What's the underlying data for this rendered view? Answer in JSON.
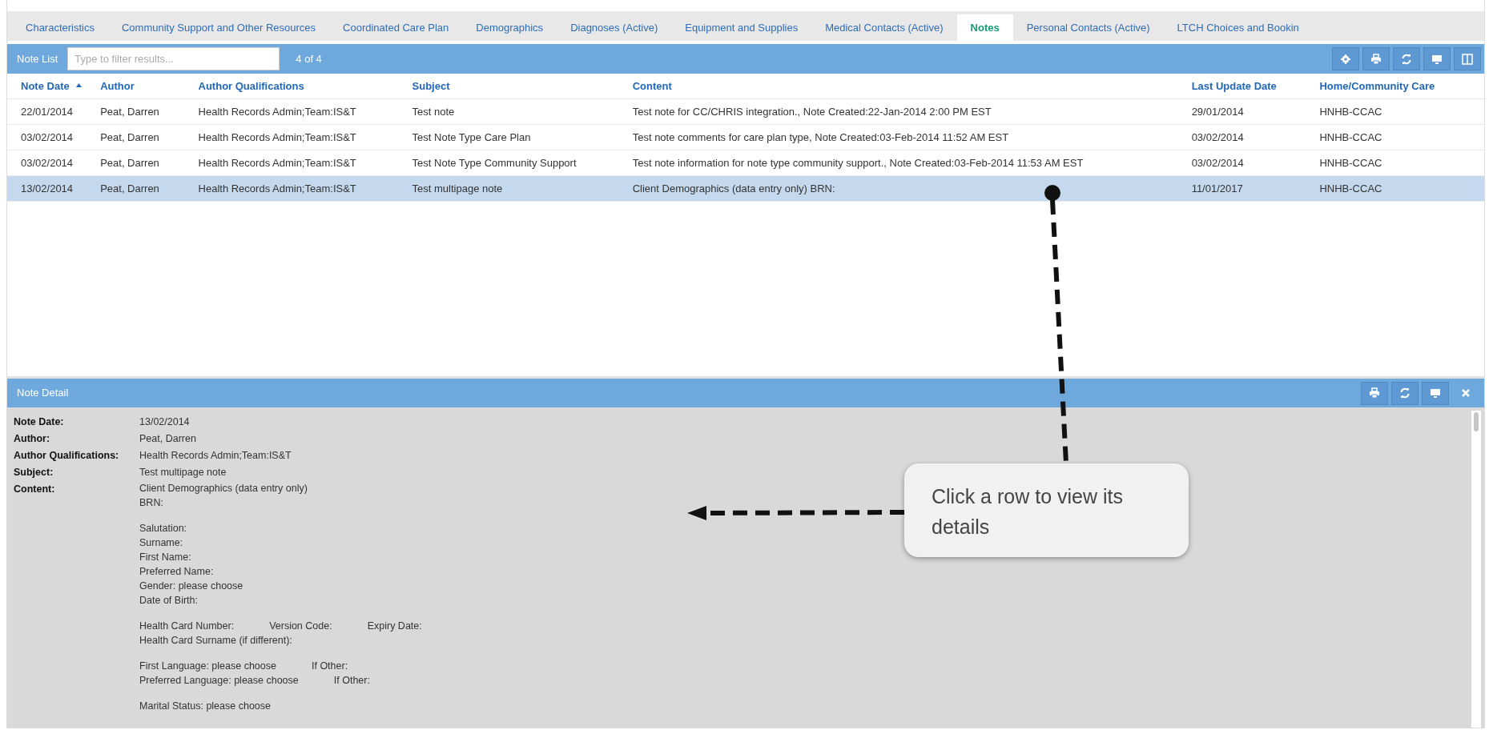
{
  "tabs": [
    {
      "label": "Characteristics",
      "selected": false
    },
    {
      "label": "Community Support and Other Resources",
      "selected": false
    },
    {
      "label": "Coordinated Care Plan",
      "selected": false
    },
    {
      "label": "Demographics",
      "selected": false
    },
    {
      "label": "Diagnoses (Active)",
      "selected": false
    },
    {
      "label": "Equipment and Supplies",
      "selected": false
    },
    {
      "label": "Medical Contacts (Active)",
      "selected": false
    },
    {
      "label": "Notes",
      "selected": true
    },
    {
      "label": "Personal Contacts (Active)",
      "selected": false
    },
    {
      "label": "LTCH Choices and Bookin",
      "selected": false
    }
  ],
  "note_list": {
    "title": "Note List",
    "filter": {
      "placeholder": "Type to filter results..."
    },
    "count": "4 of 4"
  },
  "table": {
    "columns": [
      {
        "label": "Note Date",
        "sorted": true
      },
      {
        "label": "Author",
        "sorted": false
      },
      {
        "label": "Author Qualifications",
        "sorted": false
      },
      {
        "label": "Subject",
        "sorted": false
      },
      {
        "label": "Content",
        "sorted": false
      },
      {
        "label": "Last Update Date",
        "sorted": false
      },
      {
        "label": "Home/Community Care",
        "sorted": false
      }
    ],
    "rows": [
      {
        "selected": false,
        "cells": [
          "22/01/2014",
          "Peat, Darren",
          "Health Records Admin;Team:IS&T",
          "Test note",
          "Test note for CC/CHRIS integration., Note Created:22-Jan-2014 2:00 PM EST",
          "29/01/2014",
          "HNHB-CCAC"
        ]
      },
      {
        "selected": false,
        "cells": [
          "03/02/2014",
          "Peat, Darren",
          "Health Records Admin;Team:IS&T",
          "Test Note Type Care Plan",
          "Test note comments for care plan type, Note Created:03-Feb-2014 11:52 AM EST",
          "03/02/2014",
          "HNHB-CCAC"
        ]
      },
      {
        "selected": false,
        "cells": [
          "03/02/2014",
          "Peat, Darren",
          "Health Records Admin;Team:IS&T",
          "Test Note Type Community Support",
          "Test note information for note type community support., Note Created:03-Feb-2014 11:53 AM EST",
          "03/02/2014",
          "HNHB-CCAC"
        ]
      },
      {
        "selected": true,
        "cells": [
          "13/02/2014",
          "Peat, Darren",
          "Health Records Admin;Team:IS&T",
          "Test multipage note",
          "Client Demographics (data entry only) BRN:",
          "11/01/2017",
          "HNHB-CCAC"
        ]
      }
    ]
  },
  "note_detail": {
    "title": "Note Detail",
    "fields": [
      {
        "label": "Note Date:",
        "value": "13/02/2014"
      },
      {
        "label": "Author:",
        "value": "Peat, Darren"
      },
      {
        "label": "Author Qualifications:",
        "value": "Health Records Admin;Team:IS&T"
      },
      {
        "label": "Subject:",
        "value": "Test multipage note"
      },
      {
        "label": "Content:",
        "paragraphs": [
          [
            [
              "Client Demographics (data entry only)"
            ],
            [
              "BRN:"
            ]
          ],
          [
            [
              "Salutation:"
            ],
            [
              "Surname:"
            ],
            [
              "First Name:"
            ],
            [
              "Preferred Name:"
            ],
            [
              "Gender: please choose"
            ],
            [
              "Date of Birth:"
            ]
          ],
          [
            [
              "Health Card Number:",
              "Version Code:",
              "Expiry Date:"
            ],
            [
              "Health Card Surname (if different):"
            ]
          ],
          [
            [
              "First Language: please choose",
              "If Other:"
            ],
            [
              "Preferred Language: please choose",
              "If Other:"
            ]
          ],
          [
            [
              "Marital Status: please choose"
            ]
          ]
        ]
      }
    ]
  },
  "callout": {
    "text": "Click a row to view its details"
  }
}
